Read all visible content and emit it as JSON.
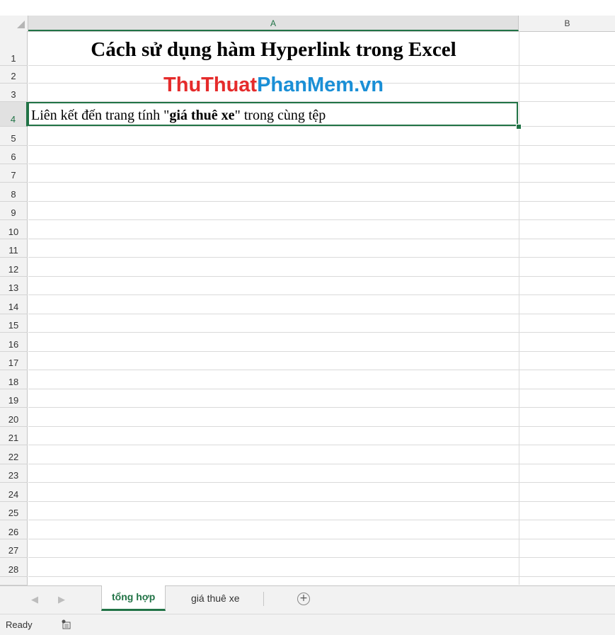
{
  "columns": [
    "A",
    "B"
  ],
  "rows": [
    "1",
    "2",
    "3",
    "4",
    "5",
    "6",
    "7",
    "8",
    "9",
    "10",
    "11",
    "12",
    "13",
    "14",
    "15",
    "16",
    "17",
    "18",
    "19",
    "20",
    "21",
    "22",
    "23",
    "24",
    "25",
    "26",
    "27",
    "28"
  ],
  "cells": {
    "A1": "Cách sử dụng hàm Hyperlink trong Excel",
    "A2_brand": {
      "part1": "ThuThuat",
      "part2": "PhanMem.vn"
    },
    "A4": {
      "prefix": "Liên kết đến trang tính \"",
      "bold": "giá thuê xe",
      "suffix": "\" trong cùng tệp"
    }
  },
  "sheet_tabs": [
    {
      "label": "tổng hợp",
      "active": true
    },
    {
      "label": "giá thuê xe",
      "active": false
    }
  ],
  "status": {
    "text": "Ready"
  },
  "icons": {
    "nav_prev": "triangle-left-icon",
    "nav_next": "triangle-right-icon",
    "add_sheet": "plus-circle-icon",
    "macro": "macro-record-icon"
  },
  "colors": {
    "excel_green": "#217346",
    "brand_red": "#e52b2b",
    "brand_blue": "#1a8fd6"
  }
}
